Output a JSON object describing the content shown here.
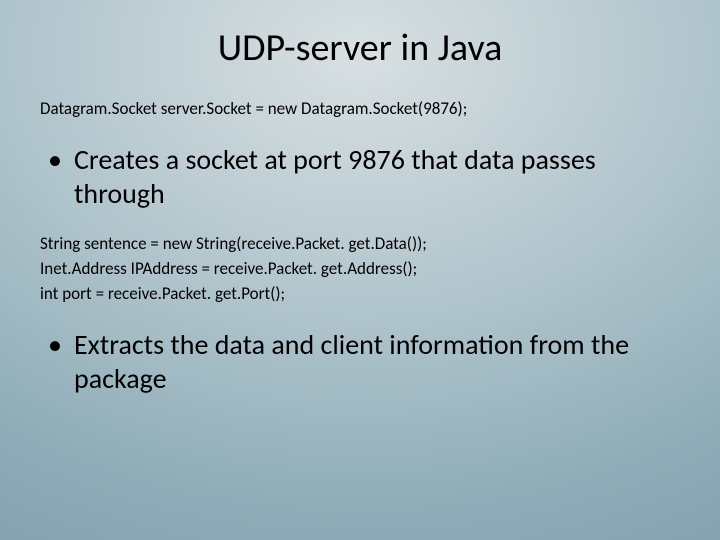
{
  "title": "UDP-server in Java",
  "code1": {
    "line1": "Datagram.Socket server.Socket = new Datagram.Socket(9876);"
  },
  "bullet1": "Creates a socket at port 9876 that data passes through",
  "code2": {
    "line1": "String sentence = new String(receive.Packet. get.Data());",
    "line2": "Inet.Address IPAddress = receive.Packet. get.Address();",
    "line3": "int port = receive.Packet. get.Port();"
  },
  "bullet2": "Extracts the data and client information from the package"
}
